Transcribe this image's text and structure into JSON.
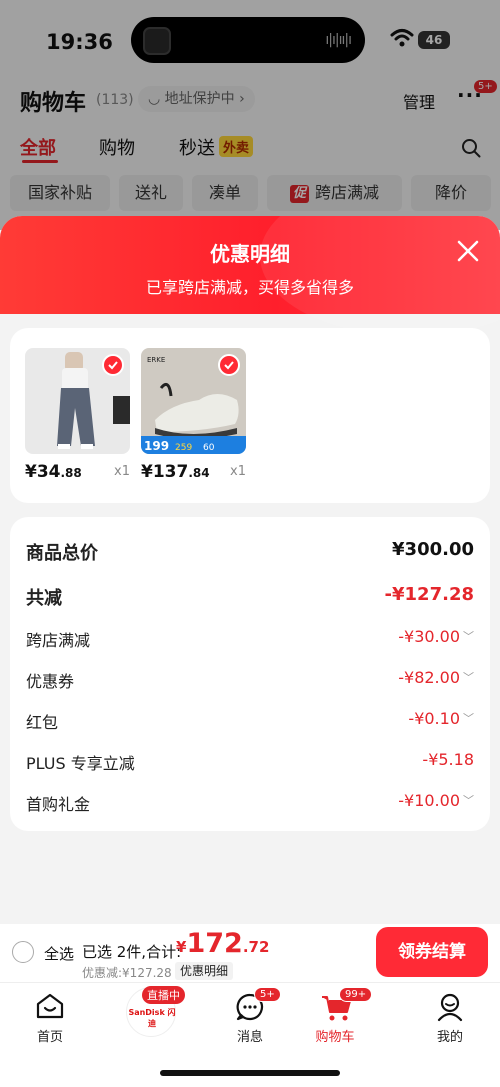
{
  "status_bar": {
    "time": "19:36",
    "battery": "46"
  },
  "header": {
    "title": "购物车",
    "count": "(113)",
    "address_protect": "地址保护中",
    "manage": "管理",
    "more_badge": "5+"
  },
  "tabs": [
    {
      "label": "全部"
    },
    {
      "label": "购物"
    },
    {
      "label": "秒送",
      "tag": "外卖"
    }
  ],
  "filter_chips": [
    "国家补贴",
    "送礼",
    "凑单",
    "跨店满减",
    "降价"
  ],
  "promo_tag": "促",
  "sheet": {
    "title": "优惠明细",
    "subtitle": "已享跨店满减，买得多省得多",
    "items": [
      {
        "price_int": "¥34",
        "price_dec": ".88",
        "qty": "x1"
      },
      {
        "price_int": "¥137",
        "price_dec": ".84",
        "qty": "x1",
        "promo_prices": [
          "199",
          "259",
          "60"
        ]
      }
    ],
    "summary": {
      "total_label": "商品总价",
      "total_value": "¥300.00",
      "reduce_label": "共减",
      "reduce_value": "-¥127.28",
      "rows": [
        {
          "label": "跨店满减",
          "value": "-¥30.00"
        },
        {
          "label": "优惠券",
          "value": "-¥82.00"
        },
        {
          "label": "红包",
          "value": "-¥0.10"
        },
        {
          "label": "PLUS 专享立减",
          "value": "-¥5.18"
        },
        {
          "label": "首购礼金",
          "value": "-¥10.00"
        }
      ]
    }
  },
  "checkout": {
    "select_all": "全选",
    "selected_info": "已选 2件,合计:",
    "currency": "¥",
    "total_int": "172",
    "total_dec": ".72",
    "discount": "优惠减:¥127.28",
    "detail": "优惠明细",
    "button": "领券结算"
  },
  "tabbar": {
    "home": "首页",
    "live_badge": "直播中",
    "live_brand": "SanDisk 闪迪",
    "messages": "消息",
    "messages_badge": "5+",
    "cart": "购物车",
    "cart_badge": "99+",
    "me": "我的"
  },
  "colors": {
    "accent": "#e4262c",
    "header_red": "#ff2a36"
  }
}
